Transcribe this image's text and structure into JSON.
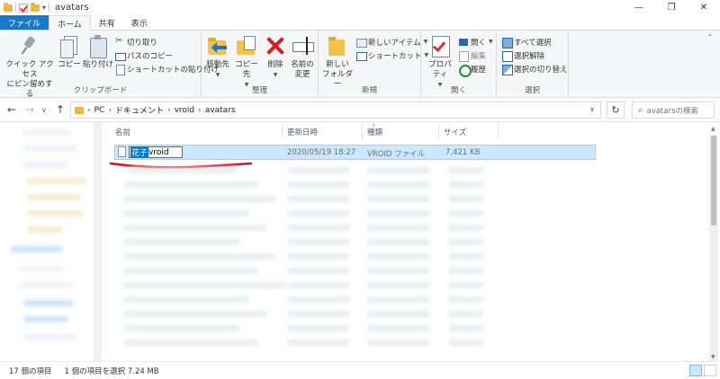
{
  "window": {
    "title": "avatars",
    "minimize": "—",
    "maximize": "❐",
    "close": "✕"
  },
  "tabs": [
    {
      "label": "ファイル"
    },
    {
      "label": "ホーム"
    },
    {
      "label": "共有"
    },
    {
      "label": "表示"
    }
  ],
  "ribbon": {
    "clipboard": {
      "group_label": "クリップボード",
      "pin_line1": "クイック アクセス",
      "pin_line2": "にピン留めする",
      "copy": "コピー",
      "paste": "貼り付け",
      "cut": "切り取り",
      "copy_path": "パスのコピー",
      "paste_shortcut": "ショートカットの貼り付け"
    },
    "organize": {
      "group_label": "整理",
      "move_to": "移動先",
      "copy_to": "コピー先",
      "delete": "削除",
      "rename_line1": "名前の",
      "rename_line2": "変更"
    },
    "new": {
      "group_label": "新規",
      "new_folder_line1": "新しい",
      "new_folder_line2": "フォルダー",
      "new_item": "新しいアイテム",
      "easy_access": "ショートカット"
    },
    "open": {
      "group_label": "開く",
      "properties": "プロパティ",
      "open": "開く",
      "edit": "編集",
      "history": "履歴"
    },
    "select": {
      "group_label": "選択",
      "select_all": "すべて選択",
      "select_none": "選択解除",
      "invert": "選択の切り替え"
    }
  },
  "address": {
    "segments": [
      "PC",
      "ドキュメント",
      "vroid",
      "avatars"
    ],
    "search_placeholder": "avatarsの検索"
  },
  "columns": {
    "name": "名前",
    "date": "更新日時",
    "type": "種類",
    "size": "サイズ"
  },
  "selected_file": {
    "name_highlight": "花子",
    "name_rest": "vroid",
    "date": "2020/05/19 18:27",
    "type": "VROID ファイル",
    "size": "7,421 KB"
  },
  "status": {
    "item_count": "17 個の項目",
    "selection": "1 個の項目を選択  7.24 MB"
  },
  "colors": {
    "accent": "#1979ca",
    "selection": "#cce8ff",
    "annotation": "#e0101a"
  }
}
